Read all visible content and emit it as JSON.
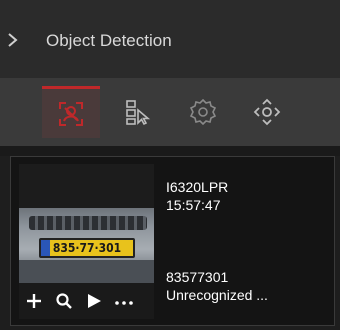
{
  "panel": {
    "title": "Object Detection"
  },
  "toolbar": {
    "items": [
      {
        "icon": "face-detection-icon",
        "active": true
      },
      {
        "icon": "target-select-icon",
        "active": false
      },
      {
        "icon": "settings-gear-icon",
        "active": false
      },
      {
        "icon": "ptz-direction-icon",
        "active": false
      }
    ]
  },
  "result": {
    "camera": "I6320LPR",
    "time": "15:57:47",
    "plate_text": "835·77·301",
    "plate_number": "83577301",
    "status": "Unrecognized ..."
  },
  "controls": [
    "add-icon",
    "search-icon",
    "play-icon",
    "more-icon"
  ],
  "colors": {
    "accent": "#c0282a",
    "plate": "#e8c21c",
    "text": "#ffffff"
  }
}
